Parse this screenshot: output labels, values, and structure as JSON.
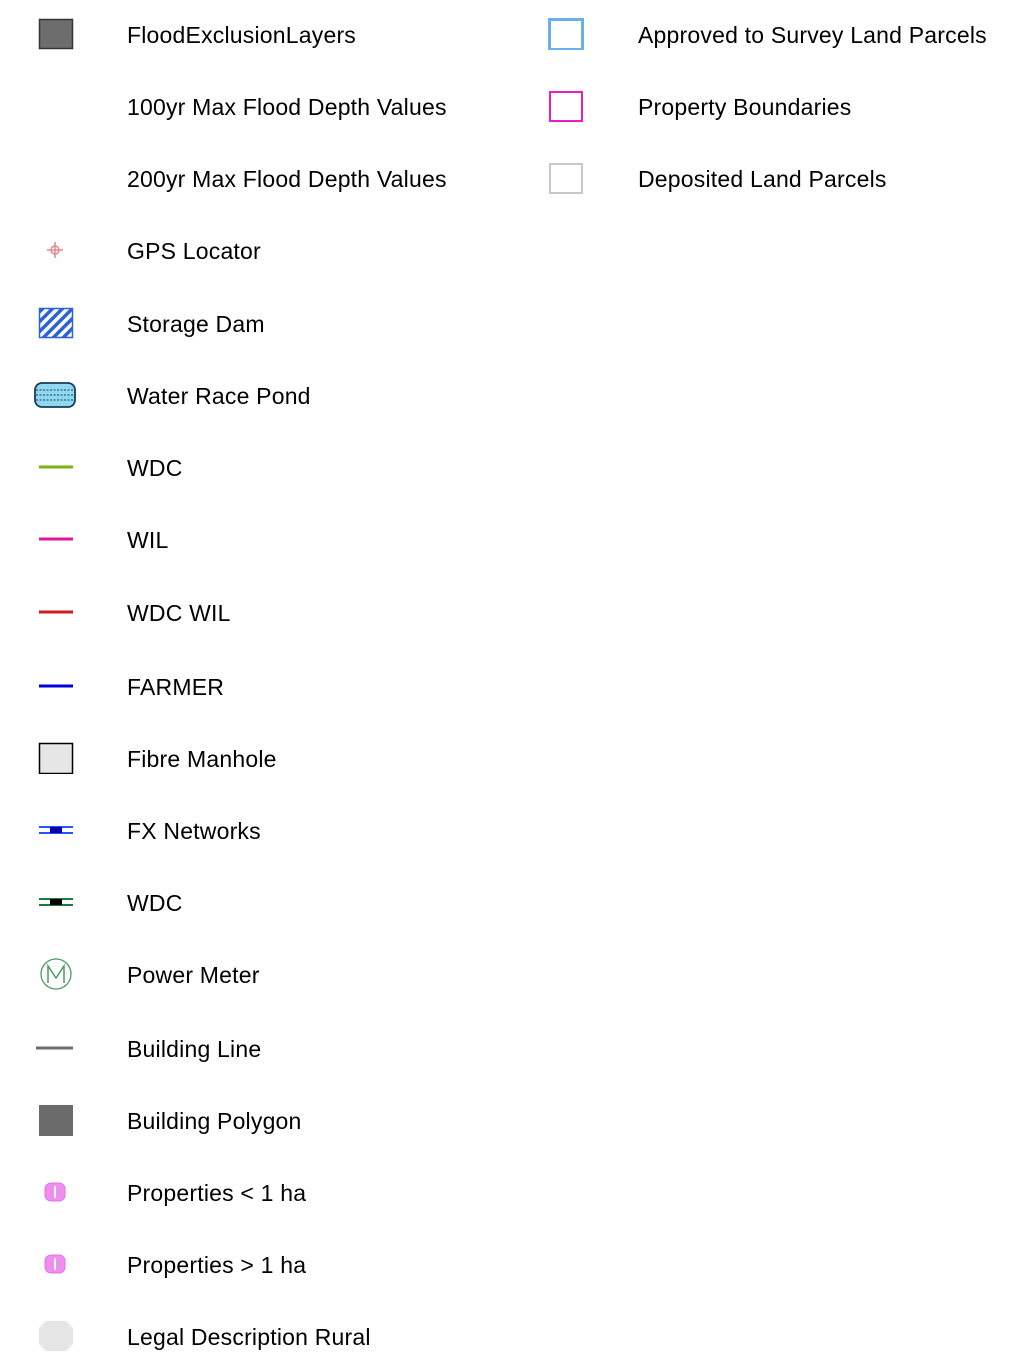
{
  "legend": {
    "left_items": [
      {
        "label": "FloodExclusionLayers",
        "icon": "dark-gray-square-icon"
      },
      {
        "label": "100yr Max Flood Depth Values",
        "icon": "none"
      },
      {
        "label": "200yr Max Flood Depth Values",
        "icon": "none"
      },
      {
        "label": "GPS Locator",
        "icon": "crosshair-marker-icon"
      },
      {
        "label": "Storage Dam",
        "icon": "hatched-blue-square-icon"
      },
      {
        "label": "Water Race Pond",
        "icon": "water-pond-icon"
      },
      {
        "label": "WDC",
        "icon": "green-line-icon"
      },
      {
        "label": "WIL",
        "icon": "magenta-line-icon"
      },
      {
        "label": "WDC WIL",
        "icon": "red-line-icon"
      },
      {
        "label": "FARMER",
        "icon": "blue-line-icon"
      },
      {
        "label": "Fibre Manhole",
        "icon": "light-gray-square-icon"
      },
      {
        "label": "FX Networks",
        "icon": "blue-cable-line-icon"
      },
      {
        "label": "WDC",
        "icon": "green-cable-line-icon"
      },
      {
        "label": "Power Meter",
        "icon": "meter-circle-icon"
      },
      {
        "label": "Building Line",
        "icon": "gray-line-icon"
      },
      {
        "label": "Building Polygon",
        "icon": "gray-filled-square-icon"
      },
      {
        "label": "Properties < 1 ha",
        "icon": "pink-marker-icon"
      },
      {
        "label": "Properties > 1 ha",
        "icon": "pink-marker-icon"
      },
      {
        "label": "Legal Description Rural",
        "icon": "light-gray-octagon-icon"
      }
    ],
    "right_items": [
      {
        "label": "Approved to Survey Land Parcels",
        "icon": "light-blue-outline-square-icon"
      },
      {
        "label": "Property Boundaries",
        "icon": "magenta-outline-square-icon"
      },
      {
        "label": "Deposited Land Parcels",
        "icon": "gray-outline-square-icon"
      }
    ]
  },
  "colors": {
    "flood_exclusion": "#6d6d6d",
    "storage_dam": "#2b63d6",
    "water_pond": "#8ed8f0",
    "wdc_line": "#7ab317",
    "wil_line": "#e0179c",
    "wdc_wil_line": "#d7191c",
    "farmer_line": "#0000e6",
    "fibre_manhole": "#e6e6e6",
    "power_meter": "#4d9966",
    "building": "#6b6b6b",
    "properties": "#f08ef0",
    "legal_rural": "#e6e6e6",
    "approved_survey": "#6aaff0",
    "property_boundaries": "#e61ec8",
    "deposited": "#c8c8c8"
  }
}
